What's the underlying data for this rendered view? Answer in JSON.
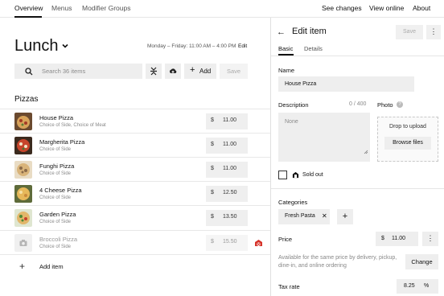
{
  "topnav": {
    "tabs": [
      {
        "label": "Overview"
      },
      {
        "label": "Menus"
      },
      {
        "label": "Modifier Groups"
      }
    ],
    "actions": [
      {
        "label": "See changes"
      },
      {
        "label": "View online"
      },
      {
        "label": "About"
      }
    ]
  },
  "menu": {
    "title": "Lunch",
    "hours": "Monday – Friday: 11:00 AM – 4:00 PM",
    "edit_label": "Edit",
    "search_placeholder": "Search 36 items",
    "add_label": "Add",
    "save_label": "Save",
    "section_title": "Pizzas",
    "items": [
      {
        "name": "House Pizza",
        "sub": "Choice of Side, Choice of Meat",
        "currency": "$",
        "price": "11.00",
        "sold_out": false
      },
      {
        "name": "Margherita Pizza",
        "sub": "Choice of Side",
        "currency": "$",
        "price": "11.00",
        "sold_out": false
      },
      {
        "name": "Funghi Pizza",
        "sub": "Choice of Side",
        "currency": "$",
        "price": "11.00",
        "sold_out": false
      },
      {
        "name": "4 Cheese Pizza",
        "sub": "Choice of Side",
        "currency": "$",
        "price": "12.50",
        "sold_out": false
      },
      {
        "name": "Garden Pizza",
        "sub": "Choice of Side",
        "currency": "$",
        "price": "13.50",
        "sold_out": false
      },
      {
        "name": "Broccoli Pizza",
        "sub": "Choice of Side",
        "currency": "$",
        "price": "15.50",
        "sold_out": true
      }
    ],
    "add_item_label": "Add item"
  },
  "edit_panel": {
    "title": "Edit item",
    "save_label": "Save",
    "tabs": [
      {
        "label": "Basic"
      },
      {
        "label": "Details"
      }
    ],
    "name_label": "Name",
    "name_value": "House Pizza",
    "description_label": "Description",
    "description_counter": "0 / 400",
    "description_placeholder": "None",
    "photo_label": "Photo",
    "drop_text": "Drop to upload",
    "browse_label": "Browse files",
    "sold_out_label": "Sold out",
    "categories_label": "Categories",
    "category_chip": "Fresh Pasta",
    "price_label": "Price",
    "price_currency": "$",
    "price_value": "11.00",
    "price_note": "Available for the same price by delivery, pickup, dine-in, and online ordering",
    "change_label": "Change",
    "tax_label": "Tax rate",
    "tax_value": "8.25",
    "tax_unit": "%"
  }
}
